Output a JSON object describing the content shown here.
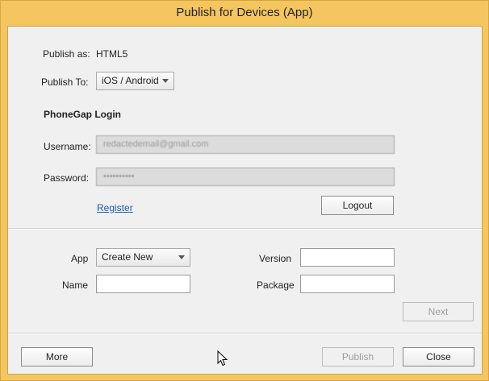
{
  "window": {
    "title": "Publish for Devices (App)"
  },
  "publish": {
    "as_label": "Publish as:",
    "as_value": "HTML5",
    "to_label": "Publish To:",
    "to_value": "iOS / Android"
  },
  "login": {
    "heading": "PhoneGap Login",
    "username_label": "Username:",
    "username_value": "redactedemail@gmail.com",
    "password_label": "Password:",
    "password_value": "••••••••••",
    "register_link": "Register",
    "logout_button": "Logout"
  },
  "app": {
    "app_label": "App",
    "app_value": "Create New",
    "name_label": "Name",
    "name_value": "",
    "version_label": "Version",
    "version_value": "",
    "package_label": "Package",
    "package_value": "",
    "next_button": "Next"
  },
  "footer": {
    "more_button": "More",
    "publish_button": "Publish",
    "close_button": "Close"
  }
}
